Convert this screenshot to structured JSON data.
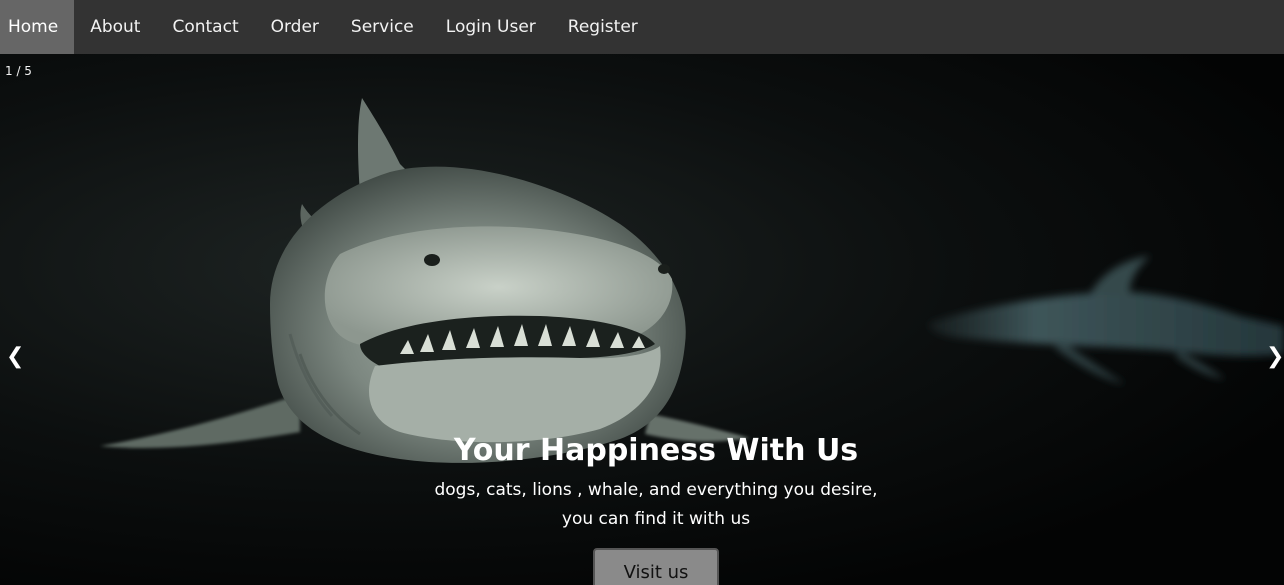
{
  "nav": {
    "items": [
      {
        "label": "Home"
      },
      {
        "label": "About"
      },
      {
        "label": "Contact"
      },
      {
        "label": "Order"
      },
      {
        "label": "Service"
      },
      {
        "label": "Login User"
      },
      {
        "label": "Register"
      }
    ],
    "active_index": 0
  },
  "slideshow": {
    "counter": "1 / 5",
    "prev_label": "❮",
    "next_label": "❯",
    "caption": {
      "title": "Your Happiness With Us",
      "line1": "dogs, cats, lions , whale, and everything you desire,",
      "line2": "you can find it with us",
      "button_label": "Visit us"
    },
    "image_subject": "shark-photo"
  },
  "colors": {
    "nav_background": "#333333",
    "nav_active": "#666666",
    "text": "#ffffff",
    "button": "#8a8a8a"
  }
}
